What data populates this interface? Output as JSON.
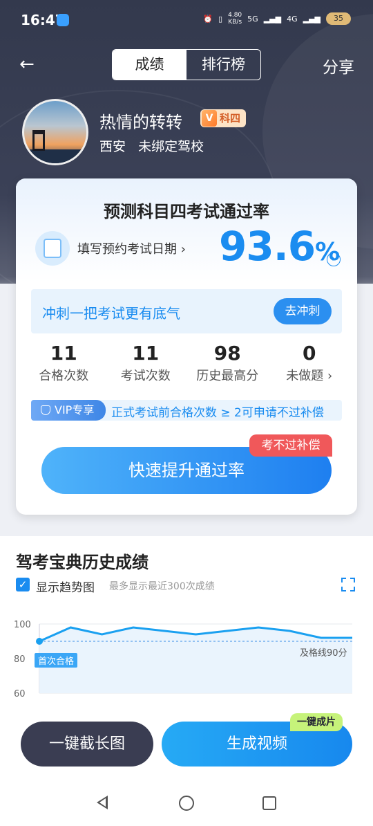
{
  "status_bar": {
    "time": "16:47",
    "net_speed": "4.80",
    "net_unit": "KB/s",
    "sig1": "5G",
    "sig2": "4G",
    "battery": "35"
  },
  "header": {
    "tabs": [
      "成绩",
      "排行榜"
    ],
    "active_tab": "成绩",
    "share_label": "分享"
  },
  "profile": {
    "name": "热情的转转",
    "badge_v": "V",
    "badge_label": "科四",
    "meta": "西安   未绑定驾校"
  },
  "card": {
    "title": "预测科目四考试通过率",
    "date_link": "填写预约考试日期",
    "rate_value": "93.6",
    "rate_unit": "%",
    "sprint_text": "冲刺一把考试更有底气",
    "sprint_button": "去冲刺",
    "stats": [
      {
        "value": "11",
        "label": "合格次数"
      },
      {
        "value": "11",
        "label": "考试次数"
      },
      {
        "value": "98",
        "label": "历史最高分"
      },
      {
        "value": "0",
        "label": "未做题"
      }
    ],
    "vip_tag": "VIP专享",
    "vip_text": "正式考试前合格次数 ≥ 2可申请不过补偿",
    "guarantee_tag": "考不过补偿",
    "boost_button": "快速提升通过率"
  },
  "history": {
    "title": "驾考宝典历史成绩",
    "show_trend_label": "显示趋势图",
    "show_trend_checked": true,
    "note": "最多显示最近300次成绩",
    "chart_data": {
      "type": "line",
      "y_ticks": [
        "100",
        "80",
        "60"
      ],
      "ylim": [
        60,
        100
      ],
      "values": [
        90,
        98,
        94,
        98,
        96,
        94,
        96,
        98,
        96,
        92,
        92
      ],
      "pass_line": 90,
      "pass_line_label": "及格线90分",
      "first_pass_label": "首次合格"
    }
  },
  "bottom": {
    "long_shot_button": "一键截长图",
    "video_button": "生成视频",
    "one_click_tag": "一键成片"
  }
}
